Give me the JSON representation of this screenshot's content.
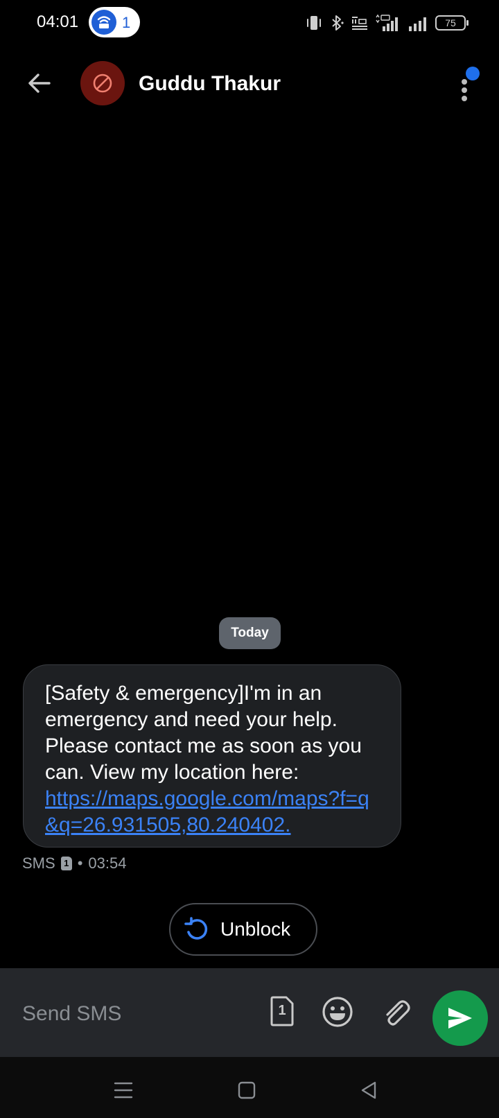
{
  "status_bar": {
    "time": "04:01",
    "hotspot_count": "1",
    "battery_level": "75"
  },
  "header": {
    "contact_name": "Guddu Thakur"
  },
  "conversation": {
    "date_label": "Today",
    "message": {
      "text": "[Safety & emergency]I'm in an emergency and need your help. Please contact me as soon as you can. View my location here:",
      "link": "https://maps.google.com/maps?f=q&q=26.931505,80.240402.",
      "channel": "SMS",
      "sim": "1",
      "separator": "•",
      "time": "03:54"
    },
    "unblock_label": "Unblock"
  },
  "compose": {
    "placeholder": "Send SMS",
    "sim": "1"
  },
  "colors": {
    "background": "#000000",
    "bubble": "#1e2023",
    "link": "#3b82f6",
    "send_button": "#149a4c",
    "avatar": "#6b150f",
    "accent_blue": "#1f6feb"
  },
  "icons": {
    "back": "arrow-left-icon",
    "avatar": "blocked-icon",
    "more": "more-vertical-icon",
    "unblock": "refresh-icon",
    "sim": "sim-card-icon",
    "emoji": "emoji-icon",
    "attach": "paperclip-icon",
    "send": "send-icon"
  }
}
